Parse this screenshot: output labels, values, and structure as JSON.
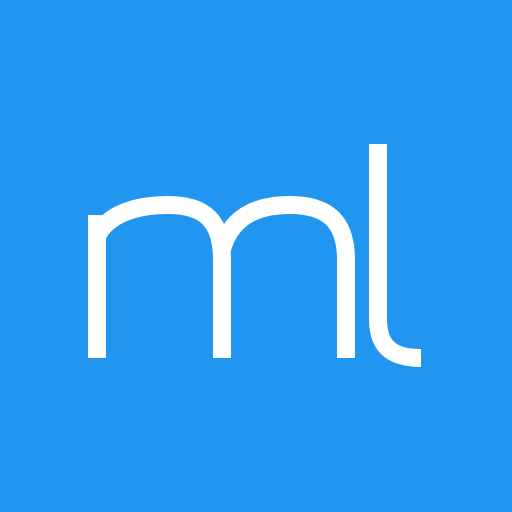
{
  "logo": {
    "text": "ml",
    "background_color": "#2196f0",
    "text_color": "#ffffff"
  }
}
